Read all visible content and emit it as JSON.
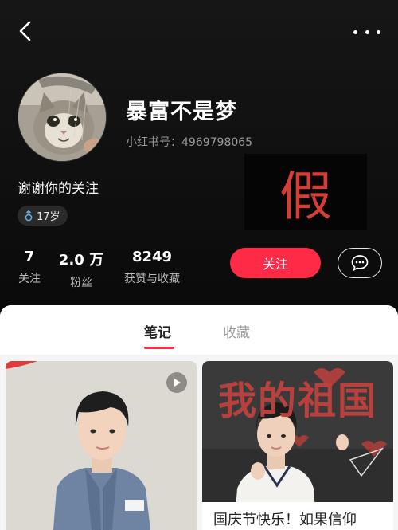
{
  "profile": {
    "username": "暴富不是梦",
    "user_id": "小红书号：4969798065",
    "bio": "谢谢你的关注",
    "age_tag": "17岁",
    "fake_label": "假"
  },
  "stats": [
    {
      "value": "7",
      "label": "关注"
    },
    {
      "value": "2.0 万",
      "label": "粉丝"
    },
    {
      "value": "8249",
      "label": "获赞与收藏"
    }
  ],
  "actions": {
    "follow_label": "关注"
  },
  "tabs": [
    {
      "label": "笔记",
      "active": true
    },
    {
      "label": "收藏",
      "active": false
    }
  ],
  "cards": [
    {
      "type": "video",
      "title": ""
    },
    {
      "type": "image",
      "title": "国庆节快乐！如果信仰",
      "board_text": "我的祖国"
    }
  ],
  "colors": {
    "accent": "#ff2a45",
    "fake_mark": "#d53e35",
    "header_bg": "#111111"
  },
  "icons": [
    "back-arrow-icon",
    "more-dots-icon",
    "male-gender-icon",
    "chat-bubble-icon",
    "play-icon"
  ]
}
